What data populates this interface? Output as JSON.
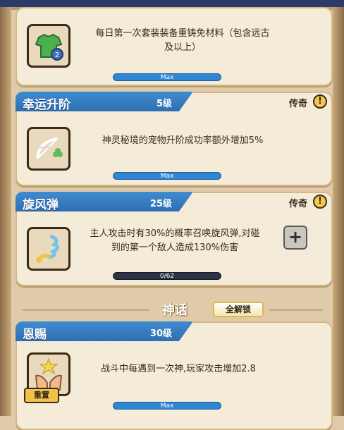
{
  "colors": {
    "accent_blue": "#2f86d3",
    "panel": "#f4ebd9",
    "border": "#d5b786",
    "text": "#3b2a18"
  },
  "cards": [
    {
      "desc": "每日第一次套装装备重铸免材料（包含远古",
      "desc2": "及以上）",
      "bar_label": "Max",
      "progress": 1.0,
      "icon": "green-shirt-icon"
    },
    {
      "title": "幸运升阶",
      "level": "5级",
      "rarity": "传奇",
      "desc": "神灵秘境的宠物升阶成功率额外增加5%",
      "bar_label": "Max",
      "progress": 1.0,
      "icon": "bow-clover-icon"
    },
    {
      "title": "旋风弹",
      "level": "25级",
      "rarity": "传奇",
      "desc": "主人攻击时有30%的概率召唤旋风弹,对碰",
      "desc2": "到的第一个敌人造成130%伤害",
      "bar_label": "0/62",
      "progress": 0.0,
      "icon": "whirlwind-icon",
      "plus": "+"
    },
    {
      "title": "恩赐",
      "level": "30级",
      "desc": "战斗中每遇到一次神,玩家攻击增加2.8",
      "bar_label": "Max",
      "progress": 1.0,
      "icon": "hands-star-icon",
      "reset": "重置"
    }
  ],
  "section": {
    "title": "神话",
    "unlock_badge": "全解锁"
  },
  "info_symbol": "!"
}
